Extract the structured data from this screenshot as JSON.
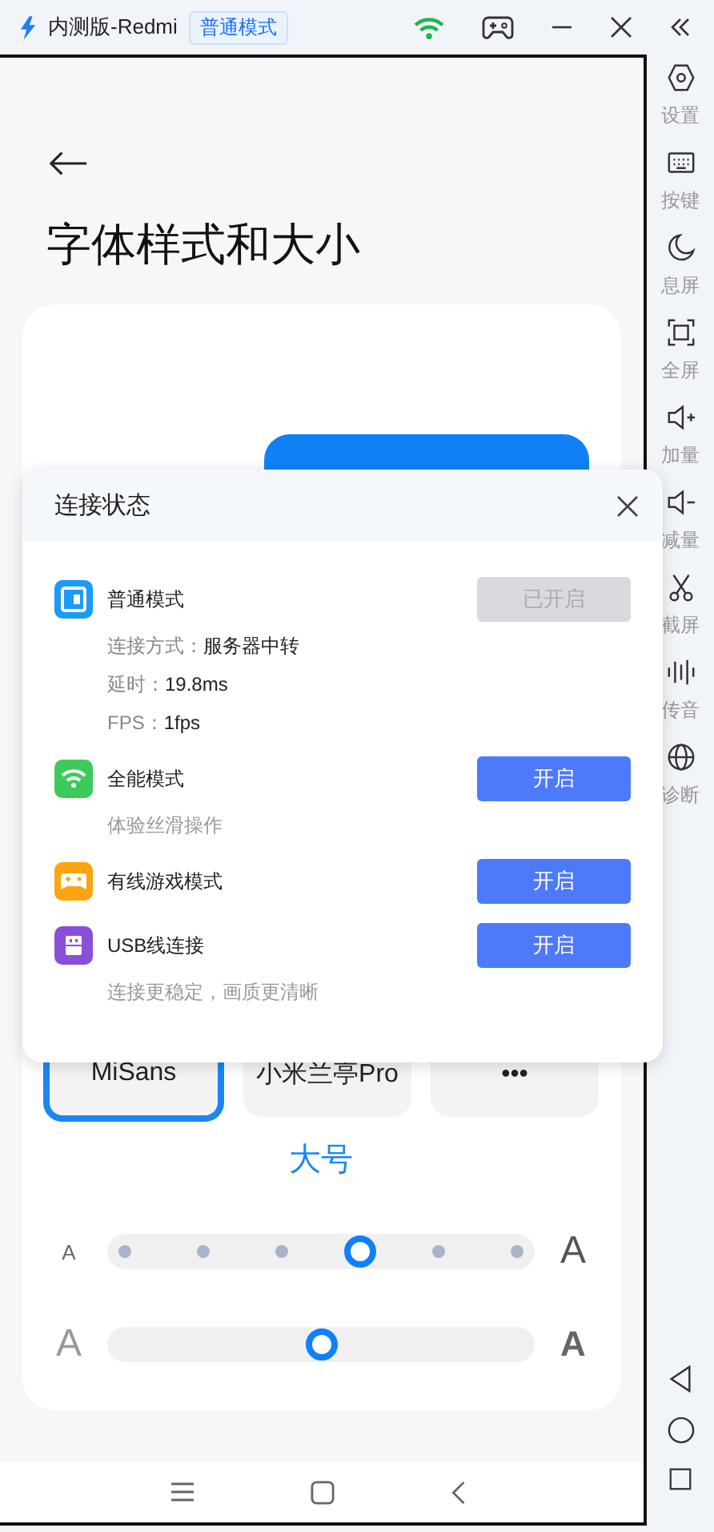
{
  "window": {
    "title": "内测版-Redmi",
    "mode_badge": "普通模式"
  },
  "phone": {
    "title": "字体样式和大小",
    "fonts": [
      {
        "label": "MiSans",
        "selected": true
      },
      {
        "label": "小米兰亭Pro",
        "selected": false
      },
      {
        "label": "•••",
        "selected": false
      }
    ],
    "size_label": "大号",
    "size_slider": {
      "left": "A",
      "right": "A",
      "level": 0.6
    },
    "weight_slider": {
      "left": "A",
      "right": "A",
      "level": 0.5
    }
  },
  "sidebar": {
    "items": [
      {
        "label": "设置"
      },
      {
        "label": "按键"
      },
      {
        "label": "息屏"
      },
      {
        "label": "全屏"
      },
      {
        "label": "加量"
      },
      {
        "label": "减量"
      },
      {
        "label": "截屏"
      },
      {
        "label": "传音"
      },
      {
        "label": "诊断"
      }
    ]
  },
  "dialog": {
    "title": "连接状态",
    "modes": [
      {
        "name": "普通模式",
        "color": "#1a9bf5",
        "details": [
          {
            "label": "连接方式：",
            "value": "服务器中转"
          },
          {
            "label": "延时：",
            "value": "19.8ms"
          },
          {
            "label": "FPS：",
            "value": "1fps"
          }
        ],
        "button": "已开启",
        "disabled": true
      },
      {
        "name": "全能模式",
        "color": "#3ccb5a",
        "description": "体验丝滑操作",
        "button": "开启",
        "disabled": false
      },
      {
        "name": "有线游戏模式",
        "color": "#fca510",
        "button": "开启",
        "disabled": false
      },
      {
        "name": "USB线连接",
        "color": "#8a4fd8",
        "description": "连接更稳定，画质更清晰",
        "button": "开启",
        "disabled": false
      }
    ]
  }
}
